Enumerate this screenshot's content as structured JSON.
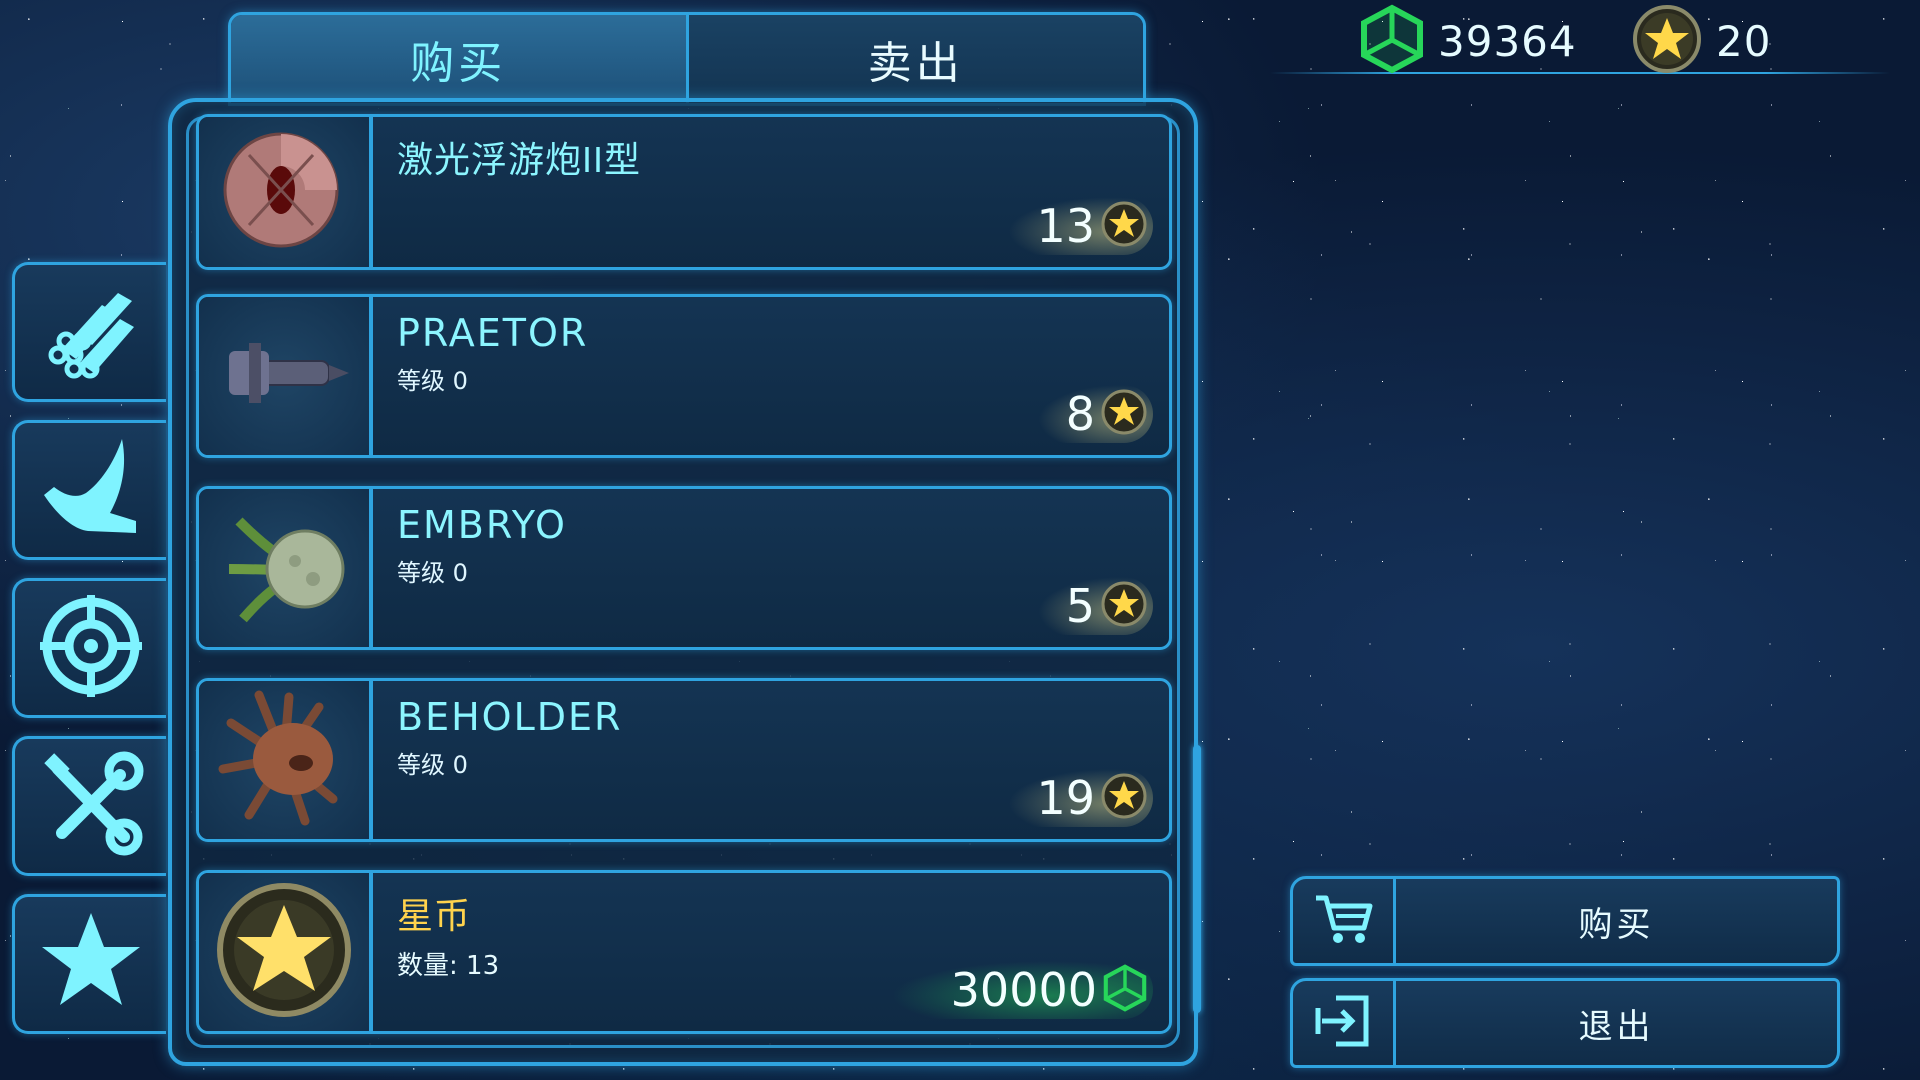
{
  "tabs": {
    "buy": "购买",
    "sell": "卖出"
  },
  "currency": {
    "cubes": {
      "icon": "green-cube-icon",
      "amount": "39364"
    },
    "stars": {
      "icon": "star-coin-icon",
      "amount": "20"
    }
  },
  "categories": [
    {
      "icon": "tubes-icon"
    },
    {
      "icon": "claw-icon"
    },
    {
      "icon": "target-icon"
    },
    {
      "icon": "tools-icon"
    },
    {
      "icon": "star-icon"
    }
  ],
  "items": [
    {
      "name": "激光浮游炮II型",
      "price": "13",
      "price_icon": "star-coin-icon"
    },
    {
      "name": "PRAETOR",
      "level": "等级 0",
      "price": "8",
      "price_icon": "star-coin-icon"
    },
    {
      "name": "EMBRYO",
      "level": "等级 0",
      "price": "5",
      "price_icon": "star-coin-icon"
    },
    {
      "name": "BEHOLDER",
      "level": "等级 0",
      "price": "19",
      "price_icon": "star-coin-icon"
    },
    {
      "name": "星币",
      "quantity": "数量: 13",
      "price": "30000",
      "price_icon": "green-cube-icon"
    }
  ],
  "actions": {
    "buy": "购买",
    "exit": "退出"
  },
  "colors": {
    "accent": "#2fa4e0",
    "title_cyan": "#8cf5ff",
    "gold": "#ffd34d",
    "cube_green": "#27d65a"
  }
}
